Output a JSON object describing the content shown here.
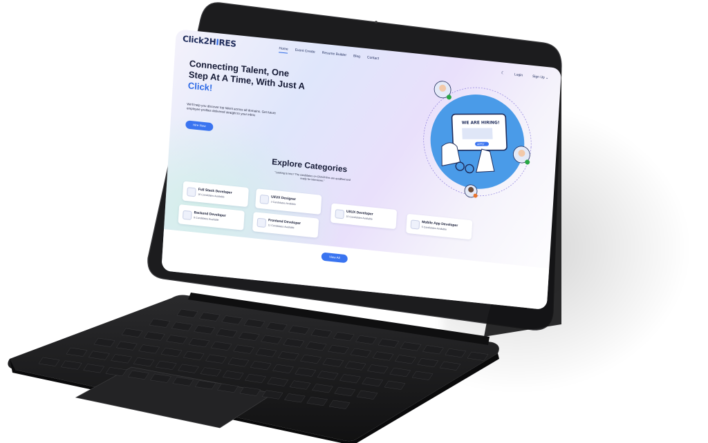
{
  "brand": {
    "logo_text_a": "Click2H",
    "logo_text_b": "I",
    "logo_text_c": "RES"
  },
  "nav": {
    "links": [
      "Home",
      "Event Create",
      "Resume Builder",
      "Blog",
      "Contact"
    ],
    "login": "Login",
    "signup": "Sign Up ⌄"
  },
  "hero": {
    "title_prefix": "Connecting Talent, One Step At A Time, With Just A ",
    "title_highlight": "Click!",
    "subtitle": "We'll help you discover top talent across all domains. Get future employee profiles delivered straight to your inbox",
    "cta": "Hire Now"
  },
  "illustration": {
    "banner": "WE ARE HIRING!",
    "apply": "APPLY"
  },
  "categories_section": {
    "title": "Explore Categories",
    "subtitle": "\"Looking to hire? The candidates on Click2Hires are qualified and ready for interviews.\"",
    "items": [
      {
        "title": "Full Stack Developer",
        "subtitle": "16 Candidates Available"
      },
      {
        "title": "UI/UX Designer",
        "subtitle": "3 Candidates Available"
      },
      {
        "title": "Backend Developer",
        "subtitle": "9 Candidates Available"
      },
      {
        "title": "Frontend Developer",
        "subtitle": "11 Candidates Available"
      },
      {
        "title": "UI/UX Developer",
        "subtitle": "10 Candidates Available"
      },
      {
        "title": "Mobile App Developer",
        "subtitle": "5 Candidates Available"
      }
    ],
    "view_all": "View All"
  },
  "colors": {
    "accent": "#3a74f0",
    "text_dark": "#151a35",
    "device_frame": "#1c1c1e"
  }
}
